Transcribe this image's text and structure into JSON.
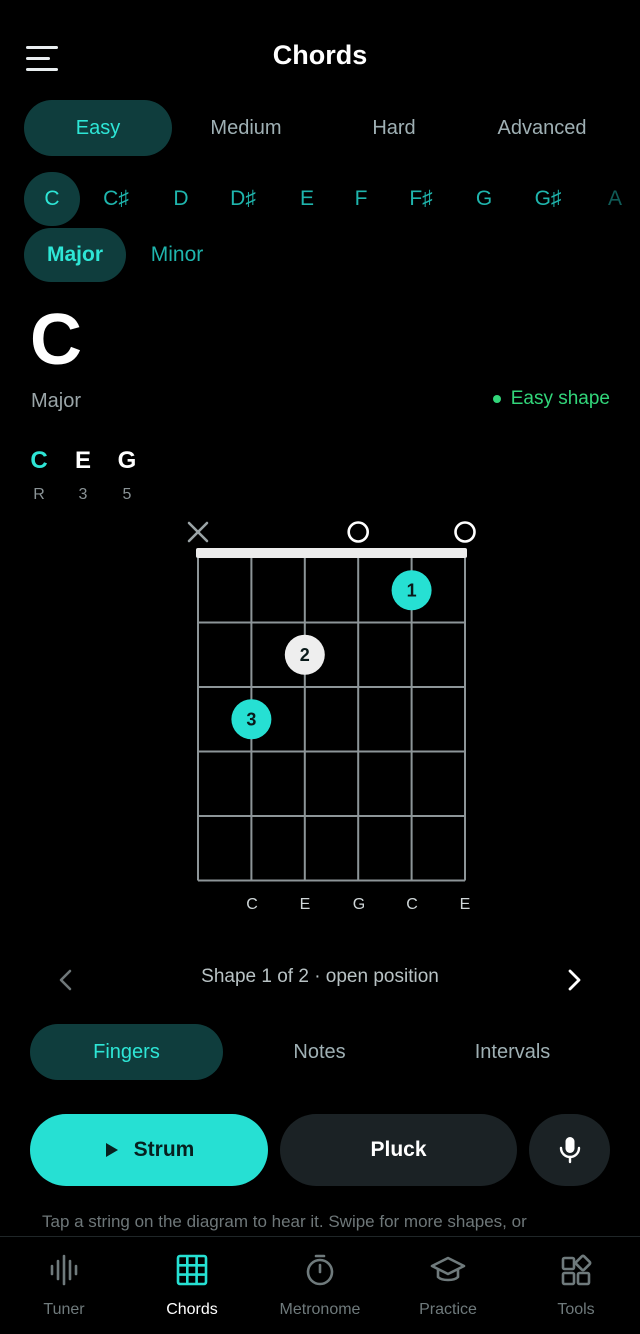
{
  "header": {
    "title": "Chords",
    "menu_icon": "hamburger-menu-icon"
  },
  "difficulty_tabs": [
    {
      "label": "Easy",
      "active": true
    },
    {
      "label": "Medium",
      "active": false
    },
    {
      "label": "Hard",
      "active": false
    },
    {
      "label": "Advanced",
      "active": false
    }
  ],
  "root_notes": [
    {
      "label": "C",
      "active": true
    },
    {
      "label": "C♯",
      "active": false
    },
    {
      "label": "D",
      "active": false
    },
    {
      "label": "D♯",
      "active": false
    },
    {
      "label": "E",
      "active": false
    },
    {
      "label": "F",
      "active": false
    },
    {
      "label": "F♯",
      "active": false
    },
    {
      "label": "G",
      "active": false
    },
    {
      "label": "G♯",
      "active": false
    },
    {
      "label": "A",
      "active": false
    }
  ],
  "qualities": [
    {
      "label": "Major",
      "active": true
    },
    {
      "label": "Minor",
      "active": false
    }
  ],
  "chord": {
    "name": "C",
    "quality": "Major",
    "shape_badge": "Easy shape",
    "notes": [
      {
        "note": "C",
        "interval": "R",
        "is_root": true
      },
      {
        "note": "E",
        "interval": "3",
        "is_root": false
      },
      {
        "note": "G",
        "interval": "5",
        "is_root": false
      }
    ]
  },
  "diagram": {
    "muted_strings": [
      0
    ],
    "open_strings": [
      3,
      5
    ],
    "frets_shown": 5,
    "fingers": [
      {
        "string": 4,
        "fret": 1,
        "finger": "1",
        "style": "teal"
      },
      {
        "string": 2,
        "fret": 2,
        "finger": "2",
        "style": "white"
      },
      {
        "string": 1,
        "fret": 3,
        "finger": "3",
        "style": "teal"
      }
    ],
    "string_labels": [
      "C",
      "E",
      "G",
      "C",
      "E"
    ]
  },
  "shape_nav": {
    "text": "Shape 1 of 2 · open position"
  },
  "view_tabs": [
    {
      "label": "Fingers",
      "active": true
    },
    {
      "label": "Notes",
      "active": false
    },
    {
      "label": "Intervals",
      "active": false
    }
  ],
  "actions": {
    "strum": "Strum",
    "pluck": "Pluck",
    "mic_icon": "microphone-icon",
    "play_icon": "play-icon"
  },
  "hint": "Tap a string on the diagram to hear it. Swipe for more shapes, or",
  "bottom_nav": [
    {
      "label": "Tuner",
      "icon": "waveform-icon",
      "active": false
    },
    {
      "label": "Chords",
      "icon": "grid-icon",
      "active": true
    },
    {
      "label": "Metronome",
      "icon": "stopwatch-icon",
      "active": false
    },
    {
      "label": "Practice",
      "icon": "graduation-cap-icon",
      "active": false
    },
    {
      "label": "Tools",
      "icon": "apps-icon",
      "active": false
    }
  ],
  "colors": {
    "accent": "#26e0d3",
    "accent_bg": "#0f3d3d",
    "easy_green": "#32d67a"
  }
}
